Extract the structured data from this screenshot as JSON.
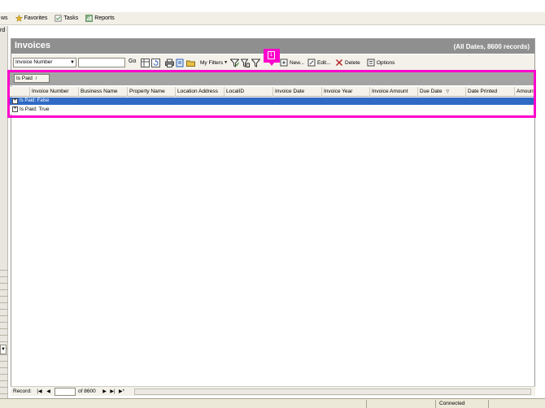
{
  "topbar": {
    "items": [
      {
        "label": "ws",
        "icon": "views-icon"
      },
      {
        "label": "Favorites",
        "icon": "favorites-icon"
      },
      {
        "label": "Tasks",
        "icon": "tasks-icon"
      },
      {
        "label": "Reports",
        "icon": "reports-icon"
      }
    ]
  },
  "left_rail": {
    "caption": "rd"
  },
  "invoices": {
    "title": "Invoices",
    "subtitle": "(All Dates, 8600 records)"
  },
  "toolbar": {
    "search_field_selected": "Invoice Number",
    "search_value": "",
    "go_label": "Go",
    "my_filters_label": "My Filters",
    "new_label": "New...",
    "edit_label": "Edit...",
    "delete_label": "Delete",
    "options_label": "Options"
  },
  "group_by": {
    "chip_label": "Is Paid"
  },
  "columns": [
    "Invoice Number",
    "Business Name",
    "Property Name",
    "Location Address",
    "LocalID",
    "Invoice Date",
    "Invoice Year",
    "Invoice Amount",
    "Due Date",
    "Date Printed",
    "Amount"
  ],
  "group_rows": [
    {
      "label": "Is Paid: False",
      "expander": "+"
    },
    {
      "label": "Is Paid: True",
      "expander": "+"
    }
  ],
  "record_nav": {
    "label": "Record:",
    "current": "",
    "of_label": "of 8600"
  },
  "status": {
    "text": "Connected"
  },
  "annotation": {
    "badge": "1"
  },
  "colors": {
    "title_bg": "#8f8f8f",
    "selection_blue": "#316ac5",
    "highlight_magenta": "#ff00cc",
    "toolbar_bg": "#f3f1ea"
  }
}
